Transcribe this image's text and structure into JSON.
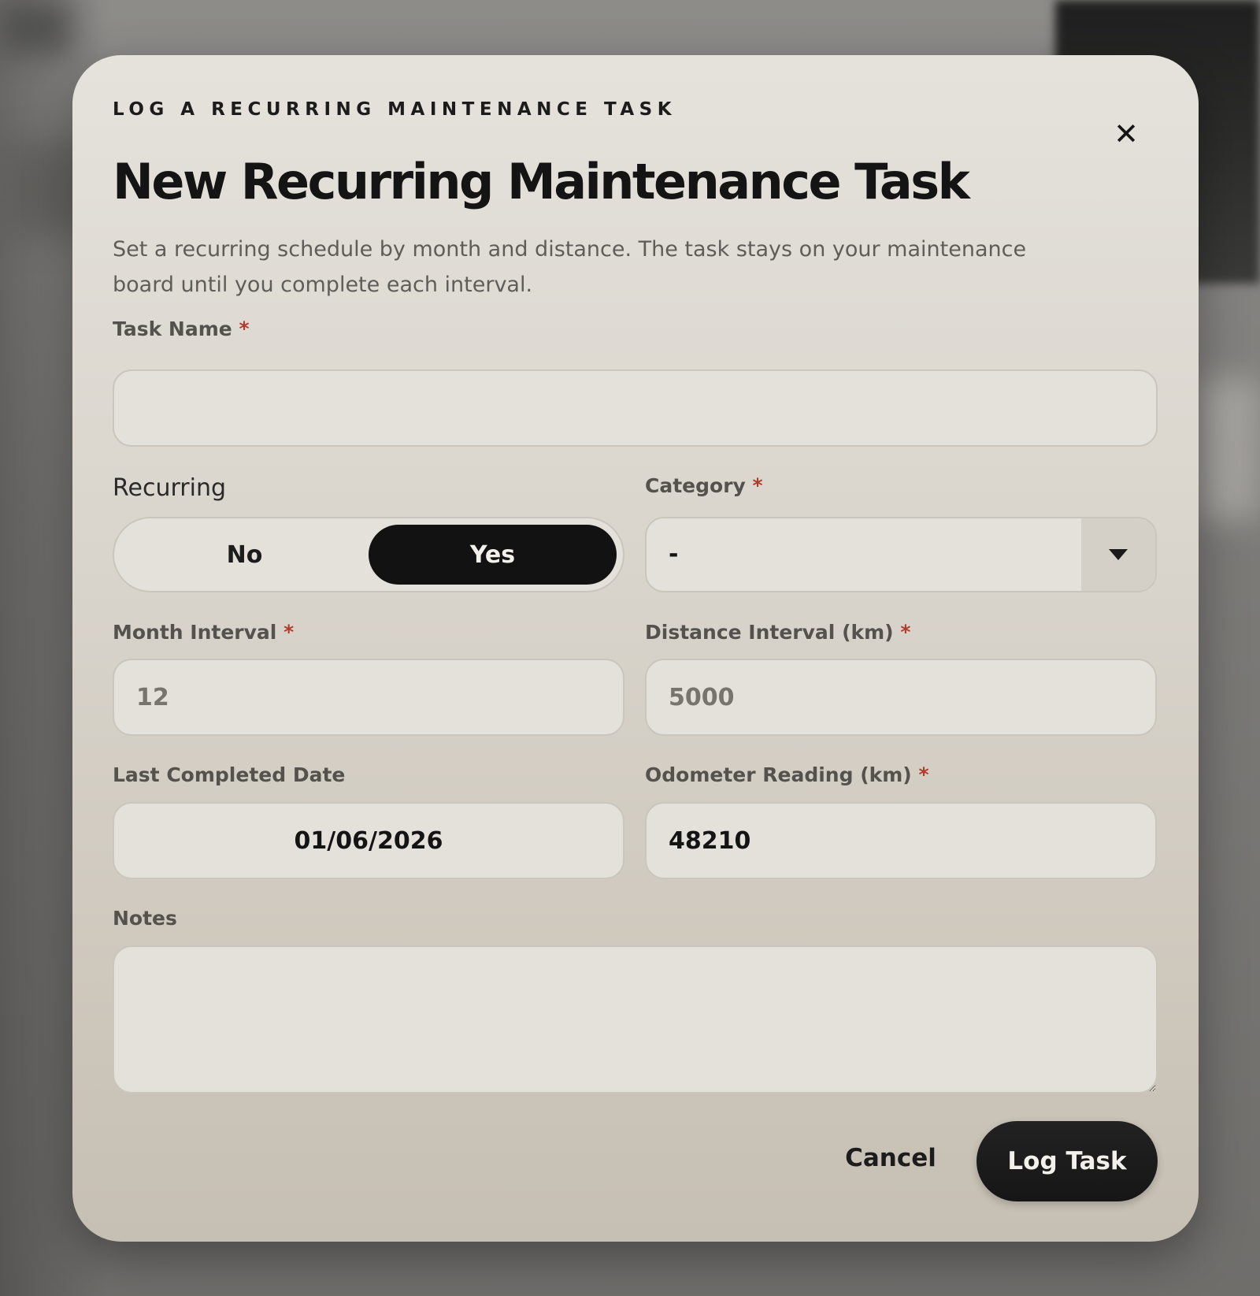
{
  "modal": {
    "eyebrow": "LOG A RECURRING MAINTENANCE TASK",
    "title": "New Recurring Maintenance Task",
    "subtitle": "Set a recurring schedule by month and distance. The task stays on your maintenance board until you complete each interval.",
    "close_icon": "close-icon"
  },
  "form": {
    "task_name": {
      "label": "Task Name",
      "required_mark": "*",
      "value": ""
    },
    "recurring": {
      "label": "Recurring",
      "options": [
        "No",
        "Yes"
      ],
      "selected": "Yes"
    },
    "category": {
      "label": "Category",
      "required_mark": "*",
      "selected": "-",
      "icon": "caret-down-icon"
    },
    "month_interval": {
      "label": "Month Interval",
      "required_mark": "*",
      "placeholder": "12",
      "value": ""
    },
    "distance_interval": {
      "label": "Distance Interval (km)",
      "required_mark": "*",
      "placeholder": "5000",
      "value": ""
    },
    "last_completed_date": {
      "label": "Last Completed Date",
      "value": "01/06/2026"
    },
    "odometer_reading": {
      "label": "Odometer Reading (km)",
      "required_mark": "*",
      "value": "48210"
    },
    "notes": {
      "label": "Notes",
      "value": ""
    }
  },
  "actions": {
    "cancel_label": "Cancel",
    "submit_label": "Log Task"
  },
  "colors": {
    "accent_dark": "#121212",
    "required": "#b2392e",
    "modal_bg_top": "#e5e2dc",
    "modal_bg_bottom": "#c6bfb3"
  }
}
